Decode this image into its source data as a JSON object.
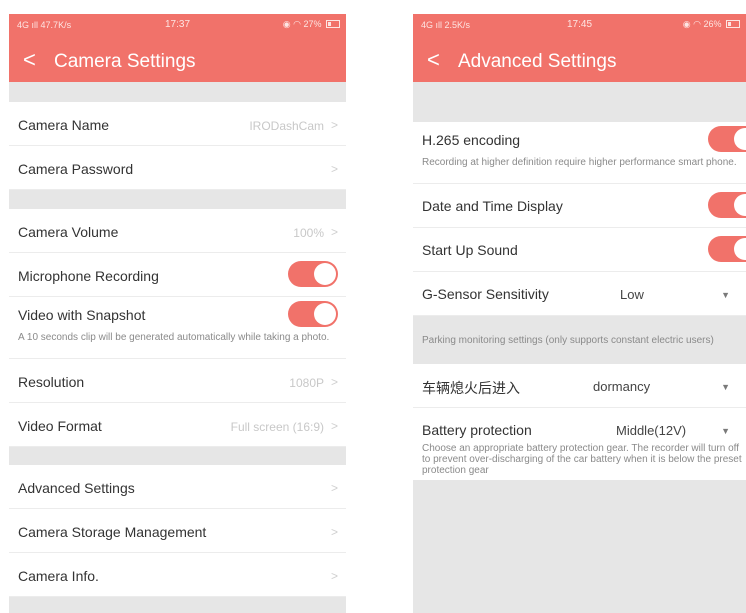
{
  "left_screen": {
    "status": {
      "network": "4G",
      "speed": "47.7K/s",
      "time": "17:37",
      "battery": "27%"
    },
    "header": {
      "back": "<",
      "title": "Camera Settings"
    },
    "rows": {
      "camera_name": {
        "label": "Camera Name",
        "value": "IRODashCam",
        "chevron": ">"
      },
      "camera_password": {
        "label": "Camera Password",
        "chevron": ">"
      },
      "camera_volume": {
        "label": "Camera Volume",
        "value": "100%",
        "chevron": ">"
      },
      "microphone_recording": {
        "label": "Microphone Recording",
        "toggle": true
      },
      "video_snapshot": {
        "label": "Video with Snapshot",
        "toggle": true,
        "desc": "A 10 seconds clip will be generated automatically while taking a photo."
      },
      "resolution": {
        "label": "Resolution",
        "value": "1080P",
        "chevron": ">"
      },
      "video_format": {
        "label": "Video Format",
        "value": "Full screen (16:9)",
        "chevron": ">"
      },
      "advanced_settings": {
        "label": "Advanced Settings",
        "chevron": ">"
      },
      "storage_management": {
        "label": "Camera Storage Management",
        "chevron": ">"
      },
      "camera_info": {
        "label": "Camera Info.",
        "chevron": ">"
      }
    }
  },
  "right_screen": {
    "status": {
      "network": "4G",
      "speed": "2.5K/s",
      "time": "17:45",
      "battery": "26%"
    },
    "header": {
      "back": "<",
      "title": "Advanced Settings"
    },
    "rows": {
      "h265": {
        "label": "H.265 encoding",
        "toggle": true,
        "desc": "Recording at higher definition require higher performance smart phone."
      },
      "date_time": {
        "label": "Date and Time Display",
        "toggle": true
      },
      "startup_sound": {
        "label": "Start Up Sound",
        "toggle": true
      },
      "gsensor": {
        "label": "G-Sensor Sensitivity",
        "value": "Low",
        "caret": "▼"
      }
    },
    "parking_note": "Parking monitoring settings (only supports constant electric users)",
    "parking_rows": {
      "after_off": {
        "label": "车辆熄火后进入",
        "value": "dormancy",
        "caret": "▼"
      },
      "battery_protection": {
        "label": "Battery protection",
        "value": "Middle(12V)",
        "caret": "▼",
        "desc": "Choose an appropriate battery protection gear. The recorder will turn off to prevent over-discharging of the car battery when it is below the preset protection gear"
      }
    }
  },
  "colors": {
    "accent": "#f1726a",
    "background": "#e6e6e6",
    "row": "#ffffff"
  }
}
